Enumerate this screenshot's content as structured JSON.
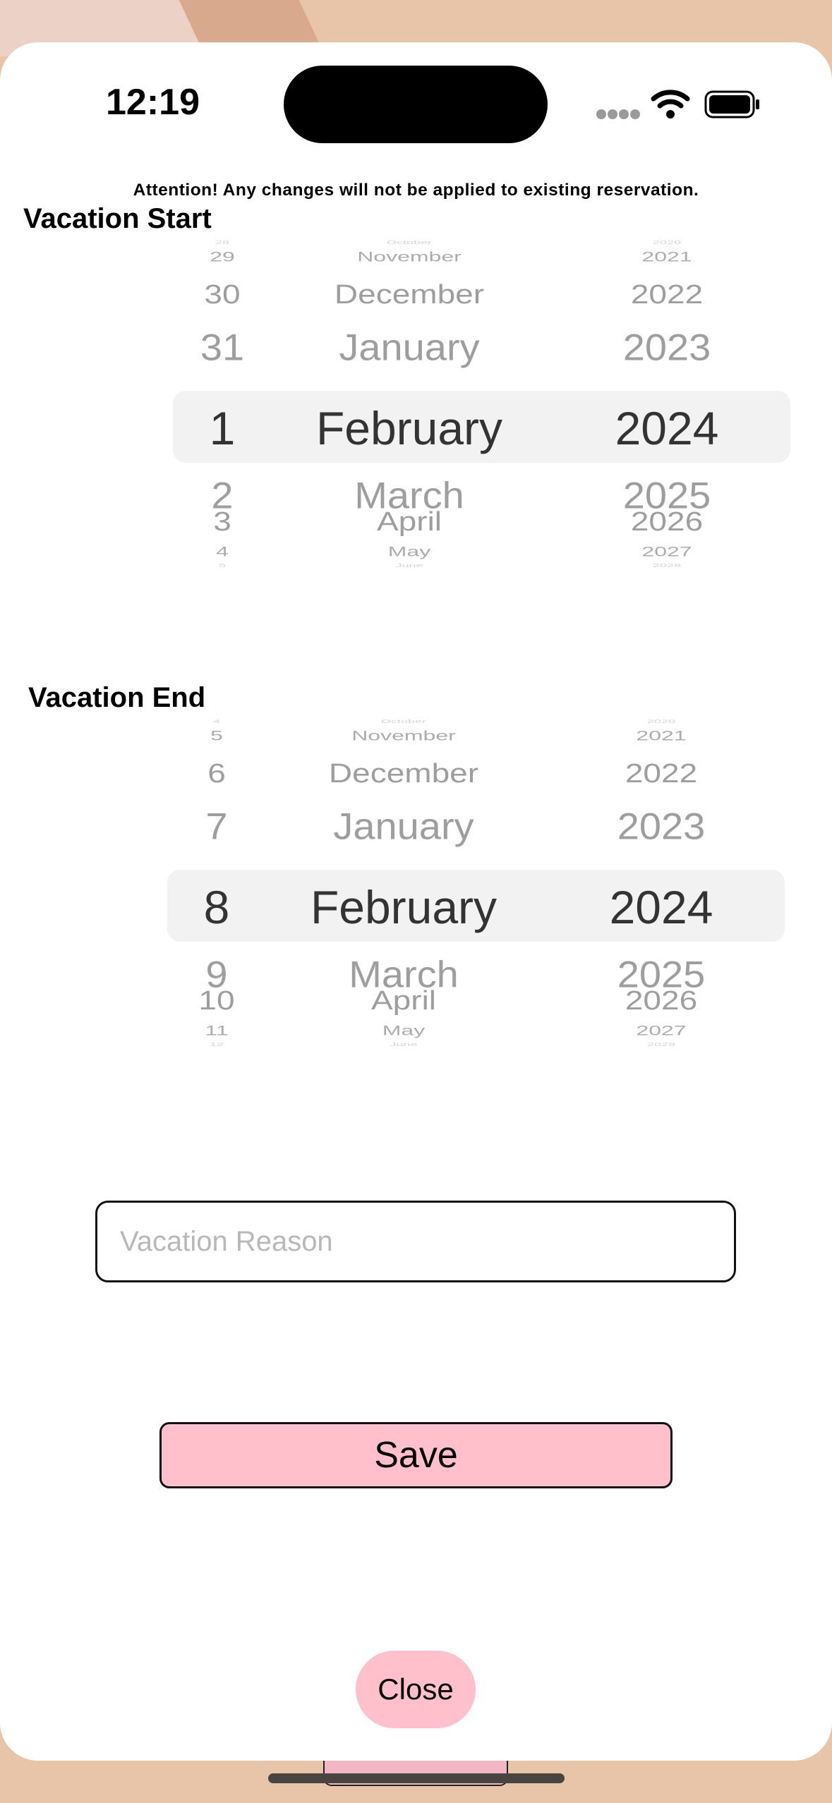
{
  "status_bar": {
    "time": "12:19"
  },
  "notice": "Attention! Any changes will not be applied to existing reservation.",
  "vacation_start": {
    "label": "Vacation Start",
    "day": {
      "items": [
        "28",
        "29",
        "30",
        "31",
        "1",
        "2",
        "3",
        "4",
        "5"
      ],
      "selected": "1"
    },
    "month": {
      "items": [
        "October",
        "November",
        "December",
        "January",
        "February",
        "March",
        "April",
        "May",
        "June"
      ],
      "selected": "February"
    },
    "year": {
      "items": [
        "2020",
        "2021",
        "2022",
        "2023",
        "2024",
        "2025",
        "2026",
        "2027",
        "2028"
      ],
      "selected": "2024"
    }
  },
  "vacation_end": {
    "label": "Vacation End",
    "day": {
      "items": [
        "4",
        "5",
        "6",
        "7",
        "8",
        "9",
        "10",
        "11",
        "12"
      ],
      "selected": "8"
    },
    "month": {
      "items": [
        "October",
        "November",
        "December",
        "January",
        "February",
        "March",
        "April",
        "May",
        "June"
      ],
      "selected": "February"
    },
    "year": {
      "items": [
        "2020",
        "2021",
        "2022",
        "2023",
        "2024",
        "2025",
        "2026",
        "2027",
        "2028"
      ],
      "selected": "2024"
    }
  },
  "reason": {
    "placeholder": "Vacation Reason",
    "value": ""
  },
  "buttons": {
    "save": "Save",
    "close": "Close"
  },
  "colors": {
    "accent_pink": "#ffc0cb",
    "selection_band": "#f2f2f2",
    "muted_text": "#9e9e9e"
  }
}
